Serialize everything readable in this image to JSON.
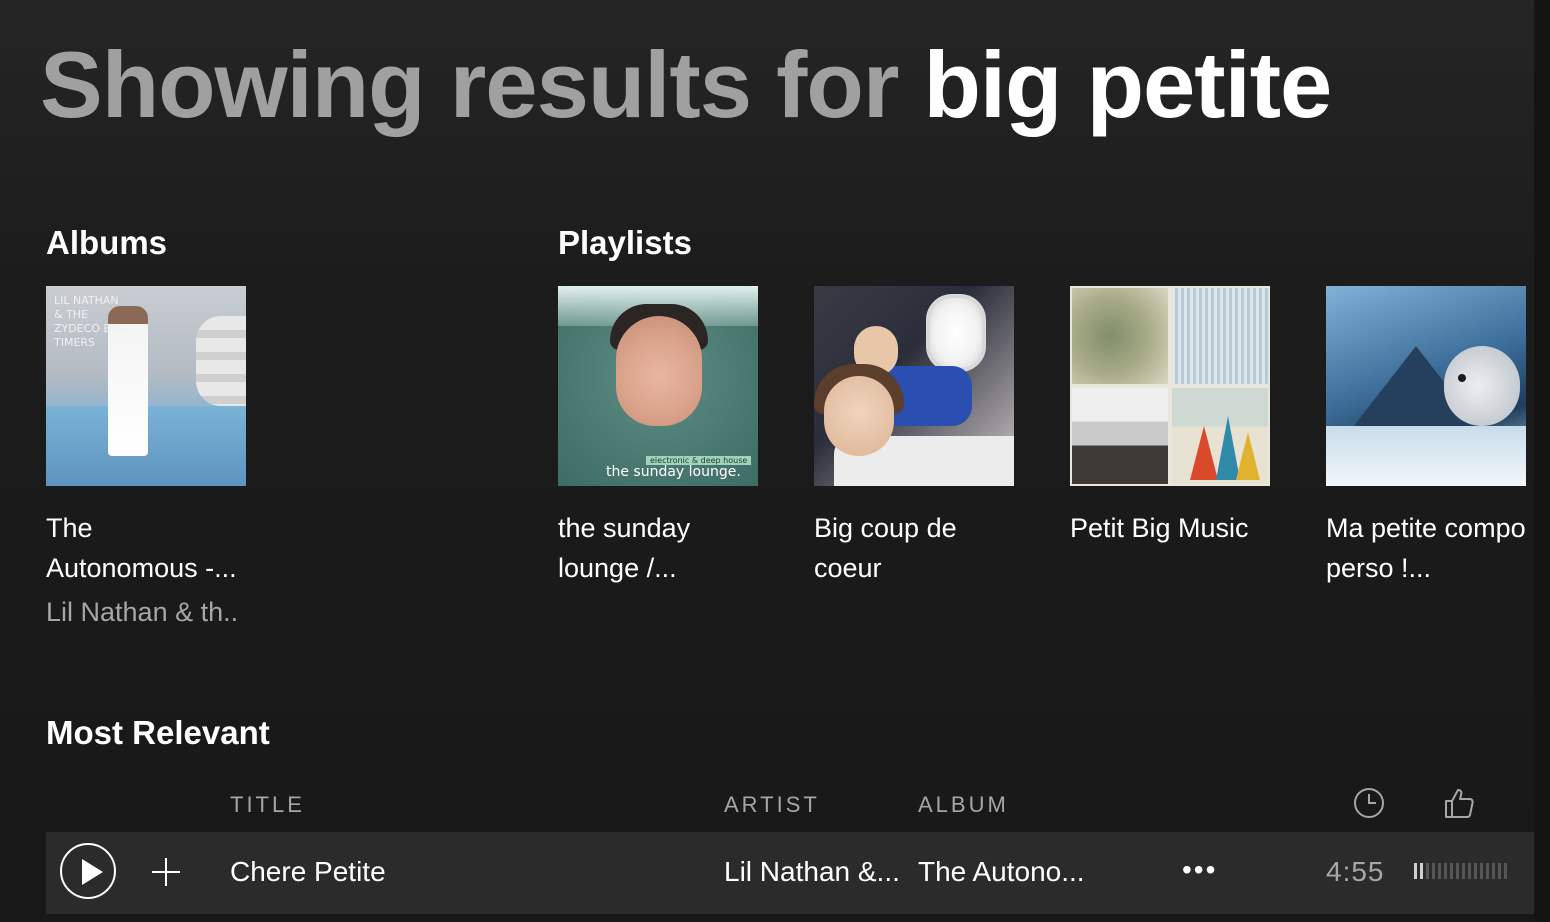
{
  "header": {
    "prefix": "Showing results for ",
    "query": "big petite"
  },
  "albums": {
    "title": "Albums",
    "items": [
      {
        "title": "The Autonomous -...",
        "subtitle": "Lil Nathan & th..",
        "art_text": "LIL NATHAN & THE ZYDECO BIG TIMERS"
      }
    ]
  },
  "playlists": {
    "title": "Playlists",
    "items": [
      {
        "title": "the sunday lounge /...",
        "art_tag": "electronic & deep house",
        "art_caption": "the sunday lounge."
      },
      {
        "title": "Big coup de coeur"
      },
      {
        "title": "Petit Big Music"
      },
      {
        "title": "Ma petite compo perso !..."
      }
    ]
  },
  "most_relevant": {
    "title": "Most Relevant",
    "columns": {
      "title": "TITLE",
      "artist": "ARTIST",
      "album": "ALBUM",
      "duration_icon": "clock-icon",
      "popularity_icon": "thumbs-up-icon"
    },
    "tracks": [
      {
        "title": "Chere Petite",
        "artist": "Lil Nathan &...",
        "album": "The Autono...",
        "more": "•••",
        "duration": "4:55",
        "popularity": 0.1
      }
    ]
  },
  "colors": {
    "background": "#1c1c1c",
    "row_highlight": "#2b2b2b",
    "muted_text": "#a6a6a6",
    "primary_text": "#ffffff"
  }
}
